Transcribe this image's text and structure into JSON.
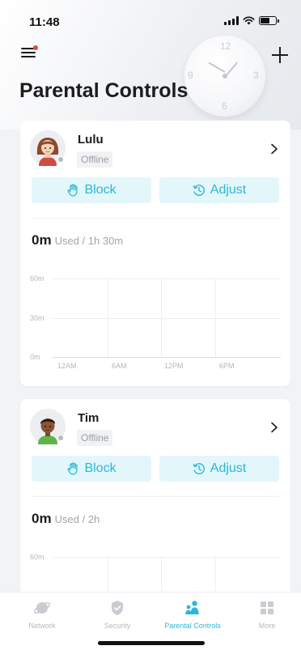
{
  "status_bar": {
    "time": "11:48"
  },
  "header": {
    "title": "Parental Controls"
  },
  "clock": {
    "numbers": [
      "12",
      "3",
      "6",
      "9"
    ]
  },
  "profiles": [
    {
      "name": "Lulu",
      "status": "Offline",
      "block_label": "Block",
      "adjust_label": "Adjust",
      "used_value": "0m",
      "used_suffix": "Used / 1h 30m",
      "chart": {
        "y_ticks": [
          "60m",
          "30m",
          "0m"
        ],
        "x_ticks": [
          "12AM",
          "6AM",
          "12PM",
          "6PM"
        ]
      }
    },
    {
      "name": "Tim",
      "status": "Offline",
      "block_label": "Block",
      "adjust_label": "Adjust",
      "used_value": "0m",
      "used_suffix": "Used / 2h",
      "chart": {
        "y_ticks": [
          "60m"
        ]
      }
    }
  ],
  "tabs": [
    {
      "label": "Network",
      "icon": "network-icon",
      "active": false
    },
    {
      "label": "Security",
      "icon": "shield-icon",
      "active": false
    },
    {
      "label": "Parental Controls",
      "icon": "family-icon",
      "active": true
    },
    {
      "label": "More",
      "icon": "grid-icon",
      "active": false
    }
  ],
  "colors": {
    "accent": "#2ab8d6",
    "accent_bg": "#e3f7fb",
    "notification": "#e8473a"
  }
}
